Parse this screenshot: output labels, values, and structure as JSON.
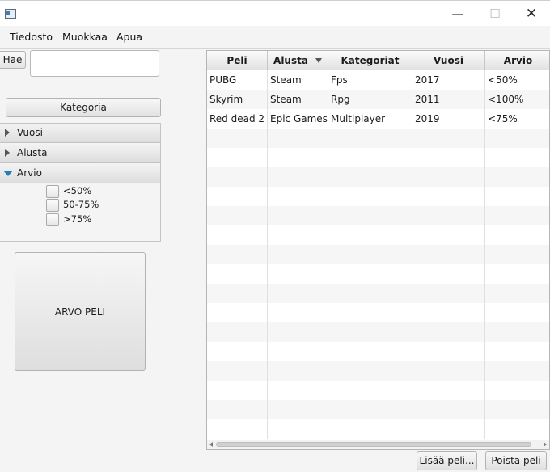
{
  "menubar": {
    "items": [
      "Tiedosto",
      "Muokkaa",
      "Apua"
    ]
  },
  "window_controls": {
    "minimize": "—",
    "maximize": "☐",
    "close": "✕"
  },
  "search": {
    "button_label": "Hae",
    "value": ""
  },
  "category_button": "Kategoria",
  "filters": {
    "sections": [
      {
        "label": "Vuosi",
        "expanded": false
      },
      {
        "label": "Alusta",
        "expanded": false
      },
      {
        "label": "Arvio",
        "expanded": true
      }
    ],
    "arvio_options": [
      "<50%",
      "50-75%",
      ">75%"
    ]
  },
  "random_button": "ARVO PELI",
  "table": {
    "columns": [
      "Peli",
      "Alusta",
      "Kategoriat",
      "Vuosi",
      "Arvio"
    ],
    "sorted_column": "Alusta",
    "rows": [
      [
        "PUBG",
        "Steam",
        "Fps",
        "2017",
        "<50%"
      ],
      [
        "Skyrim",
        "Steam",
        "Rpg",
        "2011",
        "<100%"
      ],
      [
        "Red dead 2",
        "Epic Games",
        "Multiplayer",
        "2019",
        "<75%"
      ]
    ]
  },
  "actions": {
    "add": "Lisää peli...",
    "remove": "Poista peli"
  }
}
